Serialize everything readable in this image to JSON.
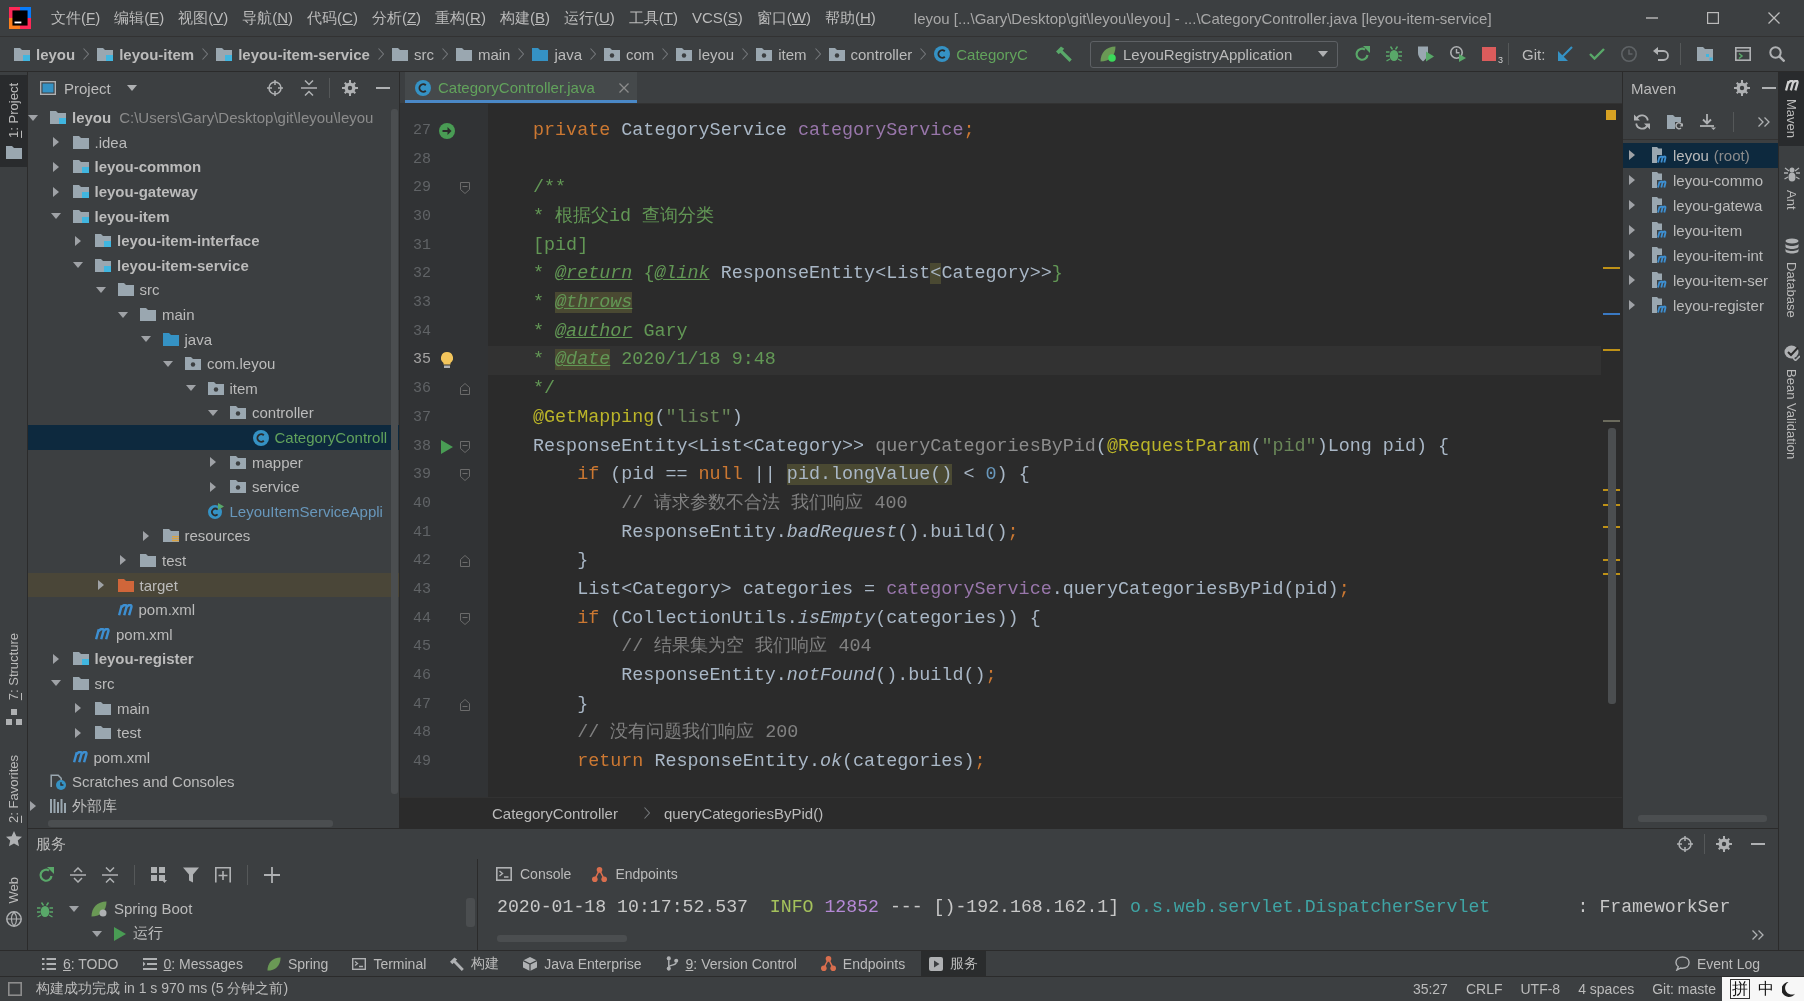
{
  "title_bar": {
    "menu": [
      {
        "before": "文件(",
        "key": "F",
        "after": ")"
      },
      {
        "before": "编辑(",
        "key": "E",
        "after": ")"
      },
      {
        "before": "视图(",
        "key": "V",
        "after": ")"
      },
      {
        "before": "导航(",
        "key": "N",
        "after": ")"
      },
      {
        "before": "代码(",
        "key": "C",
        "after": ")"
      },
      {
        "before": "分析(",
        "key": "Z",
        "after": ")"
      },
      {
        "before": "重构(",
        "key": "R",
        "after": ")"
      },
      {
        "before": "构建(",
        "key": "B",
        "after": ")"
      },
      {
        "before": "运行(",
        "key": "U",
        "after": ")"
      },
      {
        "before": "工具(",
        "key": "T",
        "after": ")"
      },
      {
        "before": "VCS(",
        "key": "S",
        "after": ")"
      },
      {
        "before": "窗口(",
        "key": "W",
        "after": ")"
      },
      {
        "before": "帮助(",
        "key": "H",
        "after": ")"
      }
    ],
    "title": "leyou [...\\Gary\\Desktop\\git\\leyou\\leyou] - ...\\CategoryController.java [leyou-item-service]"
  },
  "navigation_bar": {
    "crumbs": [
      {
        "label": "leyou",
        "kind": "module",
        "bold": true
      },
      {
        "label": "leyou-item",
        "kind": "module",
        "bold": true
      },
      {
        "label": "leyou-item-service",
        "kind": "module",
        "bold": true
      },
      {
        "label": "src",
        "kind": "folder",
        "bold": false
      },
      {
        "label": "main",
        "kind": "folder",
        "bold": false
      },
      {
        "label": "java",
        "kind": "source",
        "bold": false
      },
      {
        "label": "com",
        "kind": "package",
        "bold": false
      },
      {
        "label": "leyou",
        "kind": "package",
        "bold": false
      },
      {
        "label": "item",
        "kind": "package",
        "bold": false
      },
      {
        "label": "controller",
        "kind": "package",
        "bold": false
      },
      {
        "label": "CategoryC",
        "kind": "class",
        "bold": false,
        "color": "#62a35c"
      }
    ],
    "run_configuration": "LeyouRegistryApplication",
    "stop_badge": "3",
    "git_label": "Git:"
  },
  "left_stripe": {
    "top": [
      {
        "mnemonic": "1",
        "label": ": Project",
        "kind": "folder",
        "selected": true
      }
    ],
    "bottom": [
      {
        "mnemonic": "7",
        "label": ": Structure",
        "kind": "structure",
        "selected": false
      },
      {
        "mnemonic": "2",
        "label": ": Favorites",
        "kind": "star",
        "selected": false
      },
      {
        "label": "Web",
        "kind": "globe",
        "selected": false
      }
    ]
  },
  "project_panel": {
    "title": "Project",
    "tree": [
      {
        "label": "leyou",
        "kind": "module",
        "bold": true,
        "path": "C:\\Users\\Gary\\Desktop\\git\\leyou\\leyou",
        "expanded": true,
        "selected": false,
        "children": [
          {
            "label": ".idea",
            "kind": "folder",
            "bold": false,
            "expanded": false,
            "selected": false
          },
          {
            "label": "leyou-common",
            "kind": "module",
            "bold": true,
            "expanded": false,
            "selected": false
          },
          {
            "label": "leyou-gateway",
            "kind": "module",
            "bold": true,
            "expanded": false,
            "selected": false
          },
          {
            "label": "leyou-item",
            "kind": "module",
            "bold": true,
            "expanded": true,
            "selected": false,
            "children": [
              {
                "label": "leyou-item-interface",
                "kind": "module",
                "bold": true,
                "expanded": false,
                "selected": false
              },
              {
                "label": "leyou-item-service",
                "kind": "module",
                "bold": true,
                "expanded": true,
                "selected": false,
                "children": [
                  {
                    "label": "src",
                    "kind": "folder",
                    "bold": false,
                    "expanded": true,
                    "selected": false,
                    "children": [
                      {
                        "label": "main",
                        "kind": "folder",
                        "bold": false,
                        "expanded": true,
                        "selected": false,
                        "children": [
                          {
                            "label": "java",
                            "kind": "source",
                            "bold": false,
                            "expanded": true,
                            "selected": false,
                            "children": [
                              {
                                "label": "com.leyou",
                                "kind": "package",
                                "bold": false,
                                "expanded": true,
                                "selected": false,
                                "children": [
                                  {
                                    "label": "item",
                                    "kind": "package",
                                    "bold": false,
                                    "expanded": true,
                                    "selected": false,
                                    "children": [
                                      {
                                        "label": "controller",
                                        "kind": "package",
                                        "bold": false,
                                        "expanded": true,
                                        "selected": false,
                                        "children": [
                                          {
                                            "label": "CategoryControll",
                                            "kind": "class",
                                            "bold": false,
                                            "color": "#62a35c",
                                            "selected": true
                                          }
                                        ]
                                      },
                                      {
                                        "label": "mapper",
                                        "kind": "package",
                                        "bold": false,
                                        "expanded": false,
                                        "selected": false
                                      },
                                      {
                                        "label": "service",
                                        "kind": "package",
                                        "bold": false,
                                        "expanded": false,
                                        "selected": false
                                      }
                                    ]
                                  },
                                  {
                                    "label": "LeyouItemServiceAppli",
                                    "kind": "application",
                                    "bold": false,
                                    "color": "#6897bb",
                                    "selected": false
                                  }
                                ]
                              }
                            ]
                          },
                          {
                            "label": "resources",
                            "kind": "resources",
                            "bold": false,
                            "expanded": false,
                            "selected": false
                          }
                        ]
                      },
                      {
                        "label": "test",
                        "kind": "folder",
                        "bold": false,
                        "expanded": false,
                        "selected": false
                      }
                    ]
                  },
                  {
                    "label": "target",
                    "kind": "excluded",
                    "bold": false,
                    "expanded": false,
                    "selected": false
                  },
                  {
                    "label": "pom.xml",
                    "kind": "pom",
                    "bold": false,
                    "selected": false
                  }
                ]
              },
              {
                "label": "pom.xml",
                "kind": "pom",
                "bold": false,
                "selected": false
              }
            ]
          },
          {
            "label": "leyou-register",
            "kind": "module",
            "bold": true,
            "expanded": false,
            "selected": false
          },
          {
            "label": "src",
            "kind": "folder",
            "bold": false,
            "expanded": true,
            "selected": false,
            "children": [
              {
                "label": "main",
                "kind": "folder",
                "bold": false,
                "expanded": false,
                "selected": false
              },
              {
                "label": "test",
                "kind": "folder",
                "bold": false,
                "expanded": false,
                "selected": false
              }
            ]
          },
          {
            "label": "pom.xml",
            "kind": "pom",
            "bold": false,
            "selected": false
          }
        ]
      },
      {
        "label": "Scratches and Consoles",
        "kind": "scratches",
        "bold": false,
        "selected": false
      },
      {
        "label": "外部库",
        "kind": "library",
        "bold": false,
        "expanded": false,
        "selected": false
      }
    ]
  },
  "editor": {
    "tab": {
      "label": "CategoryController.java",
      "color": "#62a35c",
      "selected": true
    },
    "lines": [
      {
        "number": "27",
        "gutter": {
          "kind": "bean"
        },
        "current": false,
        "tokens": [
          {
            "kind": "keyword",
            "text": "private"
          },
          {
            "kind": "plain",
            "text": " CategoryService "
          },
          {
            "kind": "field",
            "text": "categoryService"
          },
          {
            "kind": "keyword",
            "text": ";"
          }
        ]
      },
      {
        "number": "28",
        "current": false
      },
      {
        "number": "29",
        "fold": {
          "kind": "start"
        },
        "current": false,
        "tokens": [
          {
            "kind": "doc",
            "text": "/**"
          }
        ]
      },
      {
        "number": "30",
        "current": false,
        "tokens": [
          {
            "kind": "doc",
            "text": "* 根据父id 查询分类"
          }
        ]
      },
      {
        "number": "31",
        "current": false,
        "tokens": [
          {
            "kind": "doc",
            "text": "[pid]"
          }
        ]
      },
      {
        "number": "32",
        "current": false,
        "tokens": [
          {
            "kind": "doc",
            "text": "* "
          },
          {
            "kind": "doctag",
            "text": "@return"
          },
          {
            "kind": "doc",
            "text": " {"
          },
          {
            "kind": "doctag",
            "text": "@link"
          },
          {
            "kind": "docref",
            "text": " ResponseEntity<List"
          },
          {
            "kind": "docref",
            "text": "<",
            "highlight": true
          },
          {
            "kind": "docref",
            "text": "Category>>"
          },
          {
            "kind": "doc",
            "text": "}"
          }
        ]
      },
      {
        "number": "33",
        "current": false,
        "tokens": [
          {
            "kind": "doc",
            "text": "* "
          },
          {
            "kind": "doctag",
            "text": "@throws",
            "highlight": true
          }
        ]
      },
      {
        "number": "34",
        "current": false,
        "tokens": [
          {
            "kind": "doc",
            "text": "* "
          },
          {
            "kind": "doctag",
            "text": "@author"
          },
          {
            "kind": "doc",
            "text": " Gary"
          }
        ]
      },
      {
        "number": "35",
        "gutter": {
          "kind": "bulb"
        },
        "current": true,
        "tokens": [
          {
            "kind": "doc",
            "text": "* "
          },
          {
            "kind": "doctag",
            "text": "@date",
            "highlight": true
          },
          {
            "kind": "doc",
            "text": " 2020/1/18 9:48"
          }
        ]
      },
      {
        "number": "36",
        "fold": {
          "kind": "end"
        },
        "current": false,
        "tokens": [
          {
            "kind": "doc",
            "text": "*/"
          }
        ]
      },
      {
        "number": "37",
        "current": false,
        "tokens": [
          {
            "kind": "annotation",
            "text": "@GetMapping"
          },
          {
            "kind": "plain",
            "text": "("
          },
          {
            "kind": "string",
            "text": "\"list\""
          },
          {
            "kind": "plain",
            "text": ")"
          }
        ]
      },
      {
        "number": "38",
        "gutter": {
          "kind": "run"
        },
        "fold": {
          "kind": "start"
        },
        "current": false,
        "tokens": [
          {
            "kind": "plain",
            "text": "ResponseEntity<List<Category>> "
          },
          {
            "kind": "unused",
            "text": "queryCategoriesByPid"
          },
          {
            "kind": "plain",
            "text": "("
          },
          {
            "kind": "annotation",
            "text": "@RequestParam"
          },
          {
            "kind": "plain",
            "text": "("
          },
          {
            "kind": "string",
            "text": "\"pid\""
          },
          {
            "kind": "plain",
            "text": ")Long pid) {"
          }
        ]
      },
      {
        "number": "39",
        "fold": {
          "kind": "start"
        },
        "current": false,
        "tokens": [
          {
            "kind": "keyword",
            "text": "    if"
          },
          {
            "kind": "plain",
            "text": " (pid == "
          },
          {
            "kind": "keyword",
            "text": "null"
          },
          {
            "kind": "plain",
            "text": " || "
          },
          {
            "kind": "plain",
            "text": "pid.longValue()",
            "highlight": true
          },
          {
            "kind": "plain",
            "text": " < "
          },
          {
            "kind": "number",
            "text": "0"
          },
          {
            "kind": "plain",
            "text": ") {"
          }
        ]
      },
      {
        "number": "40",
        "current": false,
        "tokens": [
          {
            "kind": "comment",
            "text": "        // 请求参数不合法 我们响应 400"
          }
        ]
      },
      {
        "number": "41",
        "current": false,
        "tokens": [
          {
            "kind": "plain",
            "text": "        ResponseEntity."
          },
          {
            "kind": "call",
            "text": "badRequest"
          },
          {
            "kind": "plain",
            "text": "().build()"
          },
          {
            "kind": "keyword",
            "text": ";"
          }
        ]
      },
      {
        "number": "42",
        "fold": {
          "kind": "end"
        },
        "current": false,
        "tokens": [
          {
            "kind": "plain",
            "text": "    }"
          }
        ]
      },
      {
        "number": "43",
        "current": false,
        "tokens": [
          {
            "kind": "plain",
            "text": "    List<Category> categories = "
          },
          {
            "kind": "field",
            "text": "categoryService"
          },
          {
            "kind": "plain",
            "text": ".queryCategoriesByPid(pid)"
          },
          {
            "kind": "keyword",
            "text": ";"
          }
        ]
      },
      {
        "number": "44",
        "fold": {
          "kind": "start"
        },
        "current": false,
        "tokens": [
          {
            "kind": "keyword",
            "text": "    if"
          },
          {
            "kind": "plain",
            "text": " (CollectionUtils."
          },
          {
            "kind": "call",
            "text": "isEmpty"
          },
          {
            "kind": "plain",
            "text": "(categories)) {"
          }
        ]
      },
      {
        "number": "45",
        "current": false,
        "tokens": [
          {
            "kind": "comment",
            "text": "        // 结果集为空 我们响应 404"
          }
        ]
      },
      {
        "number": "46",
        "current": false,
        "tokens": [
          {
            "kind": "plain",
            "text": "        ResponseEntity."
          },
          {
            "kind": "call",
            "text": "notFound"
          },
          {
            "kind": "plain",
            "text": "().build()"
          },
          {
            "kind": "keyword",
            "text": ";"
          }
        ]
      },
      {
        "number": "47",
        "fold": {
          "kind": "end"
        },
        "current": false,
        "tokens": [
          {
            "kind": "plain",
            "text": "    }"
          }
        ]
      },
      {
        "number": "48",
        "current": false,
        "tokens": [
          {
            "kind": "comment",
            "text": "    // 没有问题我们响应 200"
          }
        ]
      },
      {
        "number": "49",
        "current": false,
        "tokens": [
          {
            "kind": "keyword",
            "text": "    return"
          },
          {
            "kind": "plain",
            "text": " ResponseEntity."
          },
          {
            "kind": "call",
            "text": "ok"
          },
          {
            "kind": "plain",
            "text": "(categories)"
          },
          {
            "kind": "keyword",
            "text": ";"
          }
        ]
      }
    ],
    "breadcrumbs": [
      "CategoryController",
      "queryCategoriesByPid()"
    ]
  },
  "maven_panel": {
    "title": "Maven",
    "tree": [
      {
        "label": "leyou",
        "suffix": "(root)",
        "expanded": false,
        "selected": true
      },
      {
        "label": "leyou-commo",
        "expanded": false,
        "selected": false
      },
      {
        "label": "leyou-gatewa",
        "expanded": false,
        "selected": false
      },
      {
        "label": "leyou-item",
        "expanded": false,
        "selected": false
      },
      {
        "label": "leyou-item-int",
        "expanded": false,
        "selected": false
      },
      {
        "label": "leyou-item-ser",
        "expanded": false,
        "selected": false
      },
      {
        "label": "leyou-register",
        "expanded": false,
        "selected": false
      }
    ]
  },
  "right_stripe": [
    {
      "label": "Maven",
      "kind": "maven",
      "selected": true
    },
    {
      "label": "Ant",
      "kind": "ant",
      "selected": false
    },
    {
      "label": "Database",
      "kind": "database",
      "selected": false
    },
    {
      "label": "Bean Validation",
      "kind": "validation",
      "selected": false
    }
  ],
  "services_panel": {
    "title": "服务",
    "tree": [
      {
        "label": "Spring Boot",
        "kind": "springboot",
        "expanded": true,
        "selected": false,
        "children": [
          {
            "label": "运行",
            "kind": "running",
            "expanded": true,
            "selected": false
          }
        ]
      }
    ],
    "tabs": [
      {
        "label": "Console",
        "kind": "console"
      },
      {
        "label": "Endpoints",
        "kind": "endpoints"
      }
    ],
    "console": [
      [
        {
          "kind": "time",
          "text": "2020-01-18 10:17:52.537"
        },
        {
          "kind": "level",
          "text": "  INFO"
        },
        {
          "kind": "pid",
          "text": " 12852"
        },
        {
          "kind": "text",
          "text": " --- [)-192.168.162.1] "
        },
        {
          "kind": "logger",
          "text": "o.s.web.servlet.DispatcherServlet"
        },
        {
          "kind": "text",
          "text": "        : FrameworkSer"
        }
      ]
    ]
  },
  "tool_strip": {
    "items": [
      {
        "mnemonic": "6",
        "label": ": TODO",
        "kind": "todo",
        "selected": false
      },
      {
        "mnemonic": "0",
        "label": ": Messages",
        "kind": "messages",
        "selected": false
      },
      {
        "label": "Spring",
        "kind": "spring",
        "selected": false
      },
      {
        "label": "Terminal",
        "kind": "terminal",
        "selected": false
      },
      {
        "label": "构建",
        "kind": "build",
        "selected": false
      },
      {
        "label": "Java Enterprise",
        "kind": "enterprise",
        "selected": false
      },
      {
        "mnemonic": "9",
        "label": ": Version Control",
        "kind": "vcs",
        "selected": false
      },
      {
        "label": "Endpoints",
        "kind": "endpoints",
        "selected": false
      },
      {
        "label": "服务",
        "kind": "services",
        "selected": true
      }
    ],
    "right": [
      {
        "label": "Event Log",
        "kind": "log",
        "selected": false
      }
    ]
  },
  "status_bar": {
    "message": "构建成功完成 in 1 s 970 ms (5 分钟之前)",
    "widgets": [
      "35:27",
      "CRLF",
      "UTF-8",
      "4 spaces",
      "Git: maste"
    ]
  },
  "ime_toolbar": {
    "keys": [
      {
        "kind": "boxed",
        "text": "拼"
      },
      {
        "kind": "plain",
        "text": "中"
      }
    ]
  }
}
